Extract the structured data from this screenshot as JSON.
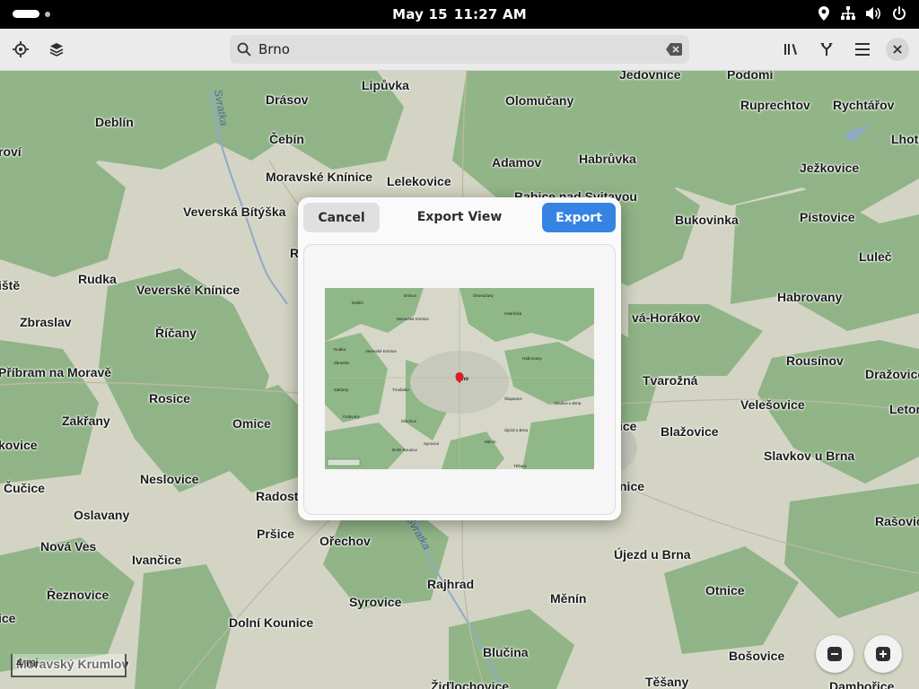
{
  "topbar": {
    "date": "May 15",
    "time": "11:27 AM",
    "icons": [
      "location-icon",
      "network-icon",
      "volume-icon",
      "power-icon"
    ]
  },
  "header": {
    "search_value": "Brno",
    "left_icons": [
      "gps-locate-icon",
      "layers-icon"
    ],
    "right_icons": [
      "library-icon",
      "route-icon",
      "hamburger-menu-icon",
      "close-icon"
    ]
  },
  "dialog": {
    "cancel_label": "Cancel",
    "title": "Export View",
    "export_label": "Export"
  },
  "map": {
    "scale_label": "4 mi",
    "places": [
      {
        "name": "Jedovnice"
      },
      {
        "name": "Podomí"
      },
      {
        "name": "Lipůvka"
      },
      {
        "name": "Drásov"
      },
      {
        "name": "Olomučany"
      },
      {
        "name": "Deblín"
      },
      {
        "name": "Ruprechtov"
      },
      {
        "name": "Rychtářov"
      },
      {
        "name": "Čebín"
      },
      {
        "name": "Lhota"
      },
      {
        "name": "roví"
      },
      {
        "name": "Adamov"
      },
      {
        "name": "Habrůvka"
      },
      {
        "name": "Moravské Knínice"
      },
      {
        "name": "Ježkovice"
      },
      {
        "name": "Lelekovice"
      },
      {
        "name": "Bukovinka"
      },
      {
        "name": "Babice nad Svitavou"
      },
      {
        "name": "Veverská Bítýška"
      },
      {
        "name": "Pístovice"
      },
      {
        "name": "R"
      },
      {
        "name": "Luleč"
      },
      {
        "name": "Rudka"
      },
      {
        "name": "ištĕ"
      },
      {
        "name": "Veverské Knínice"
      },
      {
        "name": "Habrovany"
      },
      {
        "name": "Zbraslav"
      },
      {
        "name": "vá-Horákov"
      },
      {
        "name": "Říčany"
      },
      {
        "name": "Rousínov"
      },
      {
        "name": "Příbram na Moravě"
      },
      {
        "name": "Dražovice"
      },
      {
        "name": "Tvarožná"
      },
      {
        "name": "Rosice"
      },
      {
        "name": "Velešovice"
      },
      {
        "name": "Letonice"
      },
      {
        "name": "Zakřany"
      },
      {
        "name": "Omice"
      },
      {
        "name": "ice"
      },
      {
        "name": "Blažovice"
      },
      {
        "name": "kovice"
      },
      {
        "name": "Slavkov u Brna"
      },
      {
        "name": "Neslovice"
      },
      {
        "name": "Čučice"
      },
      {
        "name": "Radostice"
      },
      {
        "name": "nice"
      },
      {
        "name": "Oslavany"
      },
      {
        "name": "Rašovice"
      },
      {
        "name": "Pršice"
      },
      {
        "name": "Nová Ves"
      },
      {
        "name": "Ořechov"
      },
      {
        "name": "Újezd u Brna"
      },
      {
        "name": "Ivančice"
      },
      {
        "name": "Řeznovice"
      },
      {
        "name": "Rajhrad"
      },
      {
        "name": "Otnice"
      },
      {
        "name": "Syrovice"
      },
      {
        "name": "Měnín"
      },
      {
        "name": "ice"
      },
      {
        "name": "Dolní Kounice"
      },
      {
        "name": "Blučina"
      },
      {
        "name": "Bošovice"
      },
      {
        "name": "Moravský Krumlov"
      },
      {
        "name": "Žiďlochovice"
      },
      {
        "name": "Těšany"
      },
      {
        "name": "Dambořice"
      }
    ],
    "rivers": [
      {
        "name": "Svratka"
      },
      {
        "name": "Svratka"
      }
    ]
  },
  "zoom": {
    "out_icon": "zoom-out-icon",
    "in_icon": "zoom-in-icon"
  },
  "colors": {
    "accent": "#3584e4",
    "forest": "#8fb787",
    "urban": "#c9ccbf",
    "field": "#d5d6c6"
  }
}
